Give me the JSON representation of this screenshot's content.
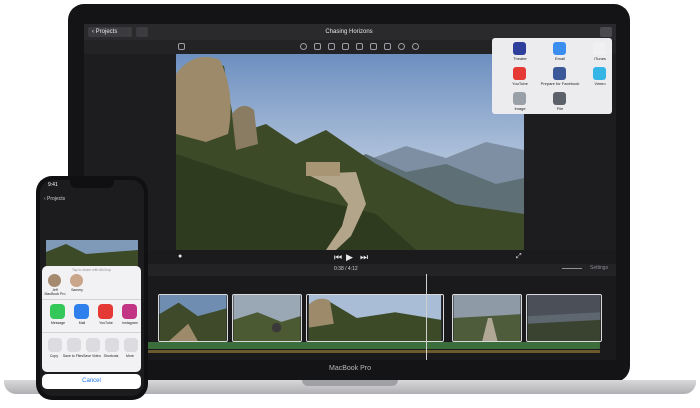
{
  "laptop": {
    "projects_button": "‹ Projects",
    "title": "Chasing Horizons",
    "timecode": "0:38 / 4:12",
    "settings": "Settings",
    "brand": "MacBook Pro",
    "share_menu": [
      {
        "label": "Theater",
        "icon": "star-icon",
        "color": "#2e3f9c"
      },
      {
        "label": "Email",
        "icon": "email-icon",
        "color": "#3b8ef0"
      },
      {
        "label": "iTunes",
        "icon": "music-icon",
        "color": "#f0f0f2"
      },
      {
        "label": "YouTube",
        "icon": "youtube-icon",
        "color": "#e53935"
      },
      {
        "label": "Prepare for Facebook",
        "icon": "facebook-icon",
        "color": "#3b5998"
      },
      {
        "label": "Vimeo",
        "icon": "vimeo-icon",
        "color": "#35b4e6"
      },
      {
        "label": "Image",
        "icon": "image-icon",
        "color": "#9aa0a8"
      },
      {
        "label": "File",
        "icon": "file-icon",
        "color": "#5c6068"
      }
    ]
  },
  "phone": {
    "time": "9:41",
    "back": "‹ Projects",
    "airdrop_hint": "Tap to share with AirDrop",
    "contacts": [
      {
        "name": "Jeff\nMacBook Pro"
      },
      {
        "name": "Sammy"
      }
    ],
    "apps": [
      {
        "label": "Message",
        "color": "#34c759"
      },
      {
        "label": "Mail",
        "color": "#2f80ed"
      },
      {
        "label": "YouTube",
        "color": "#e53935"
      },
      {
        "label": "Instagram",
        "color": "#c13584"
      }
    ],
    "actions": [
      {
        "label": "Copy"
      },
      {
        "label": "Save to Files"
      },
      {
        "label": "Save Video"
      },
      {
        "label": "Shortcuts"
      },
      {
        "label": "More"
      }
    ],
    "cancel": "Cancel"
  }
}
